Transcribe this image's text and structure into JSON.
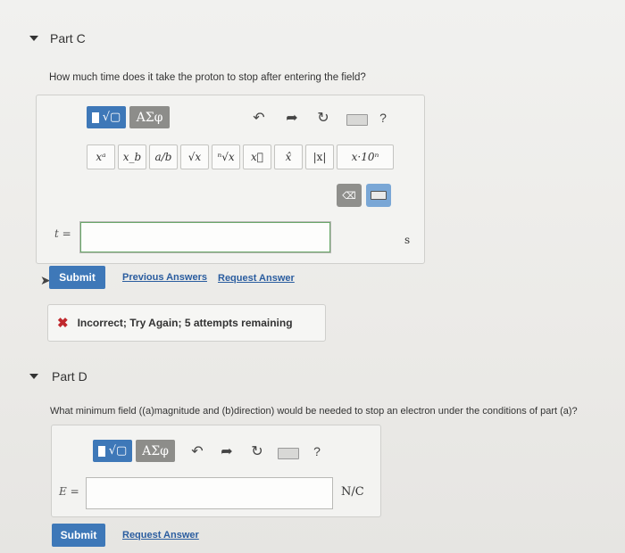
{
  "part_c": {
    "title": "Part C",
    "question": "How much time does it take the proton to stop after entering the field?",
    "toolbar": {
      "template_label": "√▢",
      "greek_label": "ΑΣφ",
      "help_label": "?"
    },
    "symbols": [
      "xᵃ",
      "x_b",
      "a/b",
      "√x",
      "ⁿ√x",
      "x⃗",
      "x̂",
      "|x|",
      "x·10ⁿ"
    ],
    "delete_label": "⌫",
    "answer": {
      "variable": "t =",
      "value": "",
      "unit": "s"
    },
    "submit_label": "Submit",
    "previous_answers_label": "Previous Answers",
    "request_answer_label": "Request Answer",
    "feedback": "Incorrect; Try Again; 5 attempts remaining"
  },
  "part_d": {
    "title": "Part D",
    "question": "What minimum field ((a)magnitude and (b)direction) would be needed to stop an electron under the conditions of part (a)?",
    "toolbar": {
      "template_label": "√▢",
      "greek_label": "ΑΣφ",
      "help_label": "?"
    },
    "answer": {
      "variable": "E =",
      "value": "",
      "unit": "N/C"
    },
    "submit_label": "Submit",
    "request_answer_label": "Request Answer"
  }
}
